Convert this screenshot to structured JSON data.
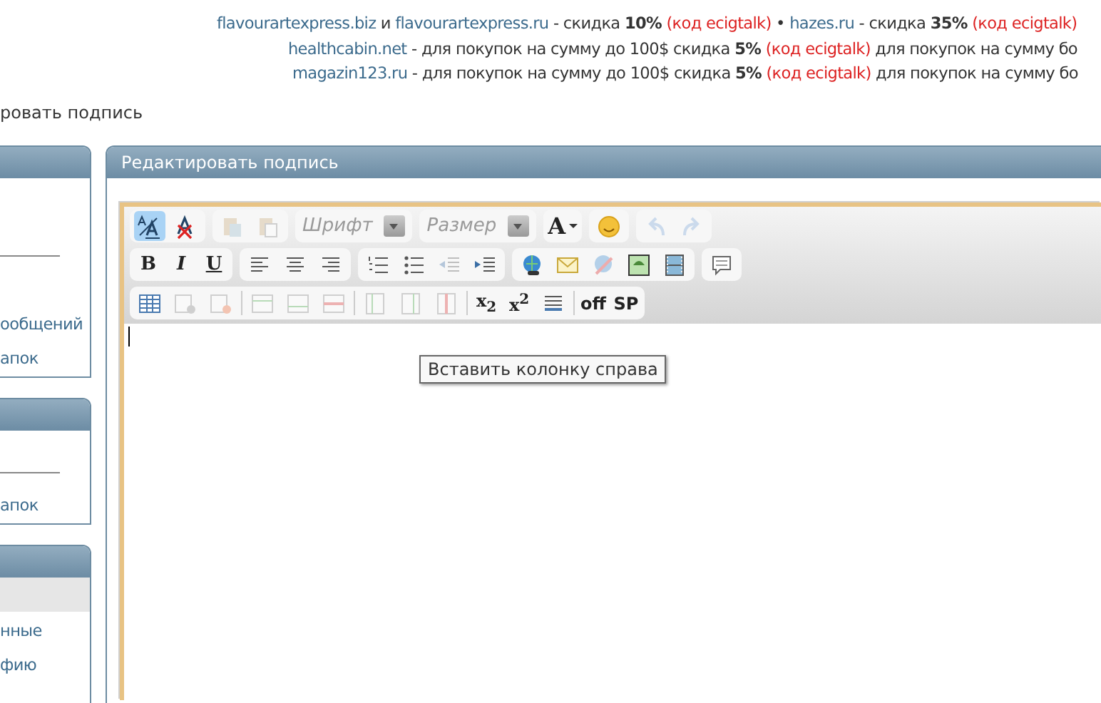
{
  "promo_lines": [
    {
      "segments": [
        {
          "kind": "link",
          "text": "flavourartexpress.biz"
        },
        {
          "kind": "text",
          "text": " и "
        },
        {
          "kind": "link",
          "text": "flavourartexpress.ru"
        },
        {
          "kind": "text",
          "text": " - скидка "
        },
        {
          "kind": "bold",
          "text": "10%"
        },
        {
          "kind": "code",
          "text": " (код ecigtalk)"
        },
        {
          "kind": "text",
          "text": " • "
        },
        {
          "kind": "link",
          "text": "hazes.ru"
        },
        {
          "kind": "text",
          "text": " - скидка "
        },
        {
          "kind": "bold",
          "text": "35%"
        },
        {
          "kind": "code",
          "text": " (код ecigtalk)"
        }
      ]
    },
    {
      "segments": [
        {
          "kind": "link",
          "text": "healthcabin.net"
        },
        {
          "kind": "text",
          "text": " - для покупок на сумму до 100$ скидка "
        },
        {
          "kind": "bold",
          "text": "5%"
        },
        {
          "kind": "code",
          "text": " (код ecigtalk)"
        },
        {
          "kind": "text",
          "text": " для покупок на сумму бо"
        }
      ]
    },
    {
      "segments": [
        {
          "kind": "link",
          "text": "magazin123.ru"
        },
        {
          "kind": "text",
          "text": " - для покупок на сумму до 100$ скидка "
        },
        {
          "kind": "bold",
          "text": "5%"
        },
        {
          "kind": "code",
          "text": " (код ecigtalk)"
        },
        {
          "kind": "text",
          "text": " для покупок на сумму бо"
        }
      ]
    }
  ],
  "breadcrumb": "ровать подпись",
  "sidebar": {
    "panels": [
      {
        "kind": "links",
        "links": [
          "ообщений",
          "апок"
        ]
      },
      {
        "kind": "short",
        "links": [
          "апок"
        ]
      },
      {
        "kind": "highlighted",
        "links": [
          "нные",
          "фию"
        ]
      }
    ]
  },
  "main": {
    "title": "Редактировать подпись",
    "toolbar": {
      "rows": [
        {
          "groups": [
            {
              "buttons": [
                {
                  "kind": "source",
                  "selected": true,
                  "disabled": false
                },
                {
                  "kind": "removeformat",
                  "selected": false,
                  "disabled": false
                }
              ]
            },
            {
              "buttons": [
                {
                  "kind": "paste",
                  "selected": false,
                  "disabled": true
                },
                {
                  "kind": "pasteword",
                  "selected": false,
                  "disabled": true
                }
              ]
            },
            {
              "select": {
                "placeholder": "Шрифт"
              }
            },
            {
              "select": {
                "placeholder": "Размер"
              }
            },
            {
              "buttons": [
                {
                  "kind": "color",
                  "label": "A",
                  "selected": false,
                  "disabled": false
                }
              ]
            },
            {
              "buttons": [
                {
                  "kind": "smiley",
                  "selected": false,
                  "disabled": false
                }
              ]
            },
            {
              "buttons": [
                {
                  "kind": "undo",
                  "selected": false,
                  "disabled": true
                },
                {
                  "kind": "redo",
                  "selected": false,
                  "disabled": true
                }
              ]
            }
          ]
        },
        {
          "groups": [
            {
              "buttons": [
                {
                  "kind": "bold",
                  "label": "B",
                  "selected": false,
                  "disabled": false
                },
                {
                  "kind": "italic",
                  "label": "I",
                  "selected": false,
                  "disabled": false
                },
                {
                  "kind": "underline",
                  "label": "U",
                  "selected": false,
                  "disabled": false
                }
              ]
            },
            {
              "buttons": [
                {
                  "kind": "alignleft",
                  "selected": false,
                  "disabled": false
                },
                {
                  "kind": "aligncenter",
                  "selected": false,
                  "disabled": false
                },
                {
                  "kind": "alignright",
                  "selected": false,
                  "disabled": false
                }
              ]
            },
            {
              "buttons": [
                {
                  "kind": "ol",
                  "selected": false,
                  "disabled": false
                },
                {
                  "kind": "ul",
                  "selected": false,
                  "disabled": false
                },
                {
                  "kind": "outdent",
                  "selected": false,
                  "disabled": true
                },
                {
                  "kind": "indent",
                  "selected": false,
                  "disabled": false
                }
              ]
            },
            {
              "buttons": [
                {
                  "kind": "link",
                  "selected": false,
                  "disabled": false
                },
                {
                  "kind": "email",
                  "selected": false,
                  "disabled": false
                },
                {
                  "kind": "unlink",
                  "selected": false,
                  "disabled": true
                },
                {
                  "kind": "image",
                  "selected": false,
                  "disabled": false
                },
                {
                  "kind": "video",
                  "selected": false,
                  "disabled": false
                }
              ]
            },
            {
              "buttons": [
                {
                  "kind": "quote",
                  "selected": false,
                  "disabled": false
                }
              ]
            }
          ]
        },
        {
          "groups": [
            {
              "buttons": [
                {
                  "kind": "table",
                  "selected": false,
                  "disabled": false
                },
                {
                  "kind": "tableprops",
                  "selected": false,
                  "disabled": true
                },
                {
                  "kind": "tabledel",
                  "selected": false,
                  "disabled": true
                },
                {
                  "kind": "sep"
                },
                {
                  "kind": "rowbefore",
                  "selected": false,
                  "disabled": true
                },
                {
                  "kind": "rowafter",
                  "selected": false,
                  "disabled": true
                },
                {
                  "kind": "rowdel",
                  "selected": false,
                  "disabled": true
                },
                {
                  "kind": "sep"
                },
                {
                  "kind": "colbefore",
                  "selected": false,
                  "disabled": true
                },
                {
                  "kind": "colafter",
                  "selected": false,
                  "disabled": true
                },
                {
                  "kind": "coldel",
                  "selected": false,
                  "disabled": true
                },
                {
                  "kind": "sep"
                },
                {
                  "kind": "sub",
                  "label": "x$_{2}$",
                  "selected": false,
                  "disabled": false
                },
                {
                  "kind": "sup",
                  "label": "x$^{2}$",
                  "selected": false,
                  "disabled": false
                },
                {
                  "kind": "hr",
                  "selected": false,
                  "disabled": false
                },
                {
                  "kind": "sep"
                },
                {
                  "kind": "text",
                  "label": "off",
                  "selected": false,
                  "disabled": false
                },
                {
                  "kind": "text",
                  "label": "SP",
                  "selected": false,
                  "disabled": false
                }
              ]
            }
          ]
        }
      ]
    },
    "tooltip": "Вставить колонку справа"
  }
}
